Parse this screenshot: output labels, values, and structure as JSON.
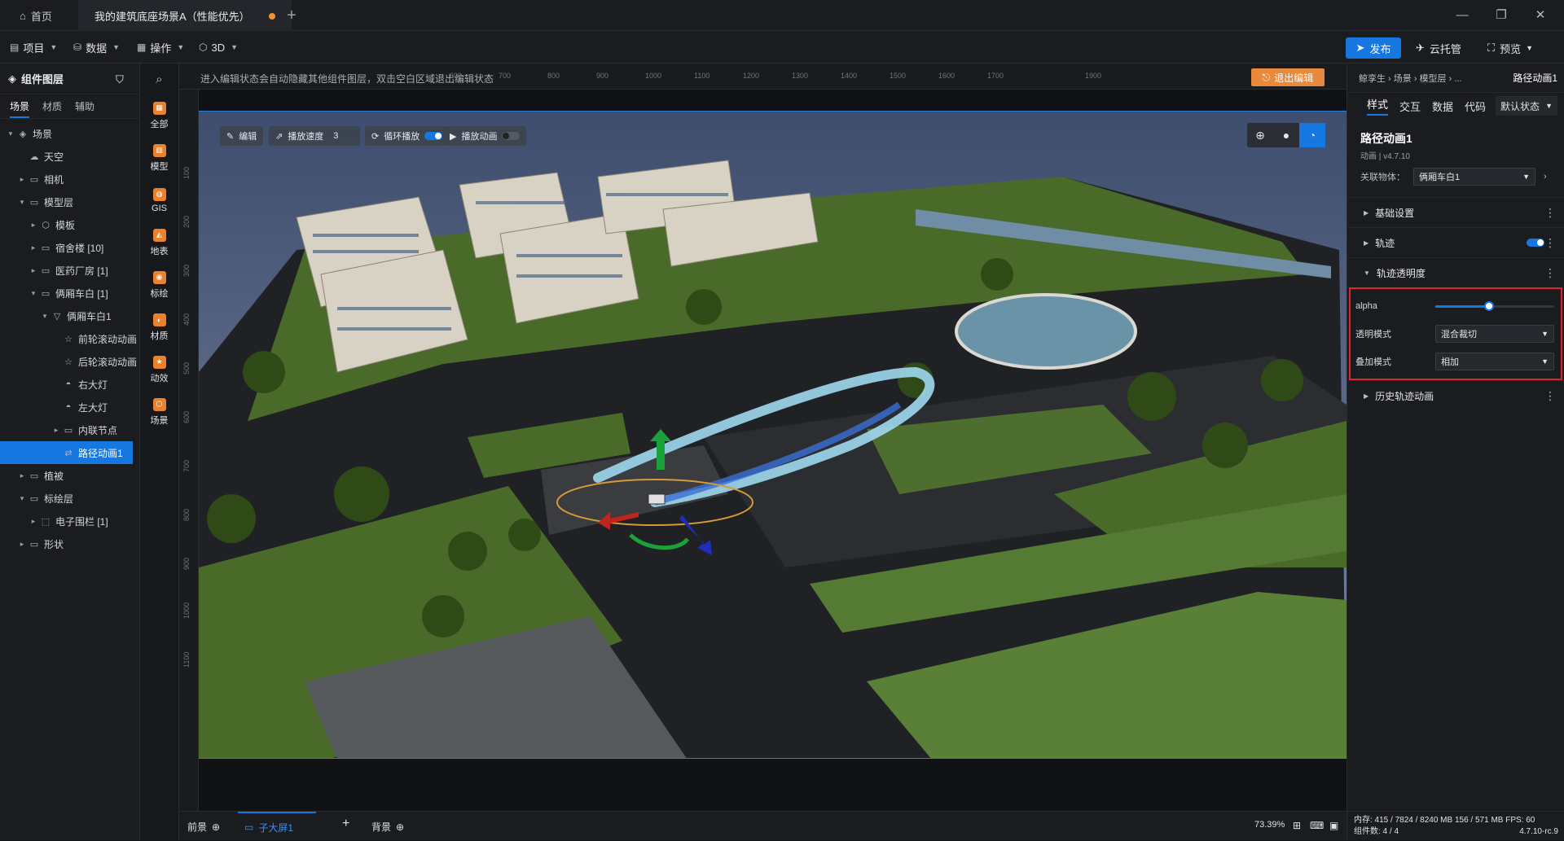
{
  "titlebar": {
    "home": "首页",
    "doc": "我的建筑底座场景A（性能优先）",
    "plus": "+",
    "minimize": "—",
    "restore": "❐",
    "close": "✕"
  },
  "menus": {
    "project": "项目",
    "data": "数据",
    "ops": "操作",
    "view": "3D"
  },
  "actions": {
    "publish": "发布",
    "cloud": "云托管",
    "preview": "预览"
  },
  "left": {
    "title": "组件图层",
    "tabs": [
      "场景",
      "材质",
      "辅助"
    ],
    "tree": [
      {
        "label": "场景",
        "indent": 0,
        "arrow": "▾",
        "icon": "◈"
      },
      {
        "label": "天空",
        "indent": 1,
        "arrow": "",
        "icon": "☁"
      },
      {
        "label": "相机",
        "indent": 1,
        "arrow": "▸",
        "icon": "▭"
      },
      {
        "label": "模型层",
        "indent": 1,
        "arrow": "▾",
        "icon": "▭"
      },
      {
        "label": "模板",
        "indent": 2,
        "arrow": "▸",
        "icon": "⬡"
      },
      {
        "label": "宿舍楼 [10]",
        "indent": 2,
        "arrow": "▸",
        "icon": "▭"
      },
      {
        "label": "医药厂房 [1]",
        "indent": 2,
        "arrow": "▸",
        "icon": "▭"
      },
      {
        "label": "俩厢车白 [1]",
        "indent": 2,
        "arrow": "▾",
        "icon": "▭"
      },
      {
        "label": "俩厢车白1",
        "indent": 3,
        "arrow": "▾",
        "icon": "▽"
      },
      {
        "label": "前轮滚动动画",
        "indent": 4,
        "arrow": "",
        "icon": "☆"
      },
      {
        "label": "后轮滚动动画",
        "indent": 4,
        "arrow": "",
        "icon": "☆"
      },
      {
        "label": "右大灯",
        "indent": 4,
        "arrow": "",
        "icon": "◓"
      },
      {
        "label": "左大灯",
        "indent": 4,
        "arrow": "",
        "icon": "◓"
      },
      {
        "label": "内联节点",
        "indent": 4,
        "arrow": "▸",
        "icon": "▭"
      },
      {
        "label": "路径动画1",
        "indent": 4,
        "arrow": "",
        "icon": "⇄",
        "selected": true
      },
      {
        "label": "植被",
        "indent": 1,
        "arrow": "▸",
        "icon": "▭"
      },
      {
        "label": "标绘层",
        "indent": 1,
        "arrow": "▾",
        "icon": "▭"
      },
      {
        "label": "电子围栏 [1]",
        "indent": 2,
        "arrow": "▸",
        "icon": "⬚"
      },
      {
        "label": "形状",
        "indent": 1,
        "arrow": "▸",
        "icon": "▭"
      }
    ]
  },
  "iconbar": [
    {
      "label": "全部",
      "icon": "▦"
    },
    {
      "label": "模型",
      "icon": "▥"
    },
    {
      "label": "GIS",
      "icon": "◍"
    },
    {
      "label": "地表",
      "icon": "◭"
    },
    {
      "label": "标绘",
      "icon": "◉"
    },
    {
      "label": "材质",
      "icon": "◐"
    },
    {
      "label": "动效",
      "icon": "★"
    },
    {
      "label": "场景",
      "icon": "⬡"
    }
  ],
  "canvas": {
    "hint": "进入编辑状态会自动隐藏其他组件图层，双击空白区域退出编辑状态",
    "exit": "退出编辑",
    "ruler_top": [
      "600",
      "700",
      "800",
      "900",
      "1000",
      "1100",
      "1200",
      "1300",
      "1400",
      "1500",
      "1600",
      "1700",
      "1900"
    ],
    "ruler_left": [
      "100",
      "200",
      "300",
      "400",
      "500",
      "600",
      "700",
      "800",
      "900",
      "1000",
      "1100"
    ],
    "controls": {
      "edit": "编辑",
      "speed_label": "播放速度",
      "speed": "3",
      "loop": "循环播放",
      "play": "播放动画"
    }
  },
  "bottom": {
    "front": "前景",
    "screen": "子大屏1",
    "add": "+",
    "back": "背景",
    "zoom": "73.39%"
  },
  "right": {
    "crumb": "鲸孪生 › 场景 › 模型层 › ...",
    "current": "路径动画1",
    "tabs": [
      "样式",
      "交互",
      "数据",
      "代码"
    ],
    "state": "默认状态",
    "name": "路径动画1",
    "version": "动画 | v4.7.10",
    "assoc_label": "关联物体：",
    "assoc_value": "俩厢车白1",
    "sections": {
      "basic": "基础设置",
      "track": "轨迹",
      "opacity": "轨迹透明度",
      "history": "历史轨迹动画"
    },
    "props": {
      "alpha_label": "alpha",
      "alpha_value": 0.45,
      "mode_label": "透明模式",
      "mode_value": "混合裁切",
      "blend_label": "叠加模式",
      "blend_value": "相加"
    },
    "status1": "内存: 415 / 7824 / 8240 MB  156 / 571 MB   FPS: 60",
    "status2a": "组件数: 4 / 4",
    "status2b": "4.7.10-rc.9"
  }
}
